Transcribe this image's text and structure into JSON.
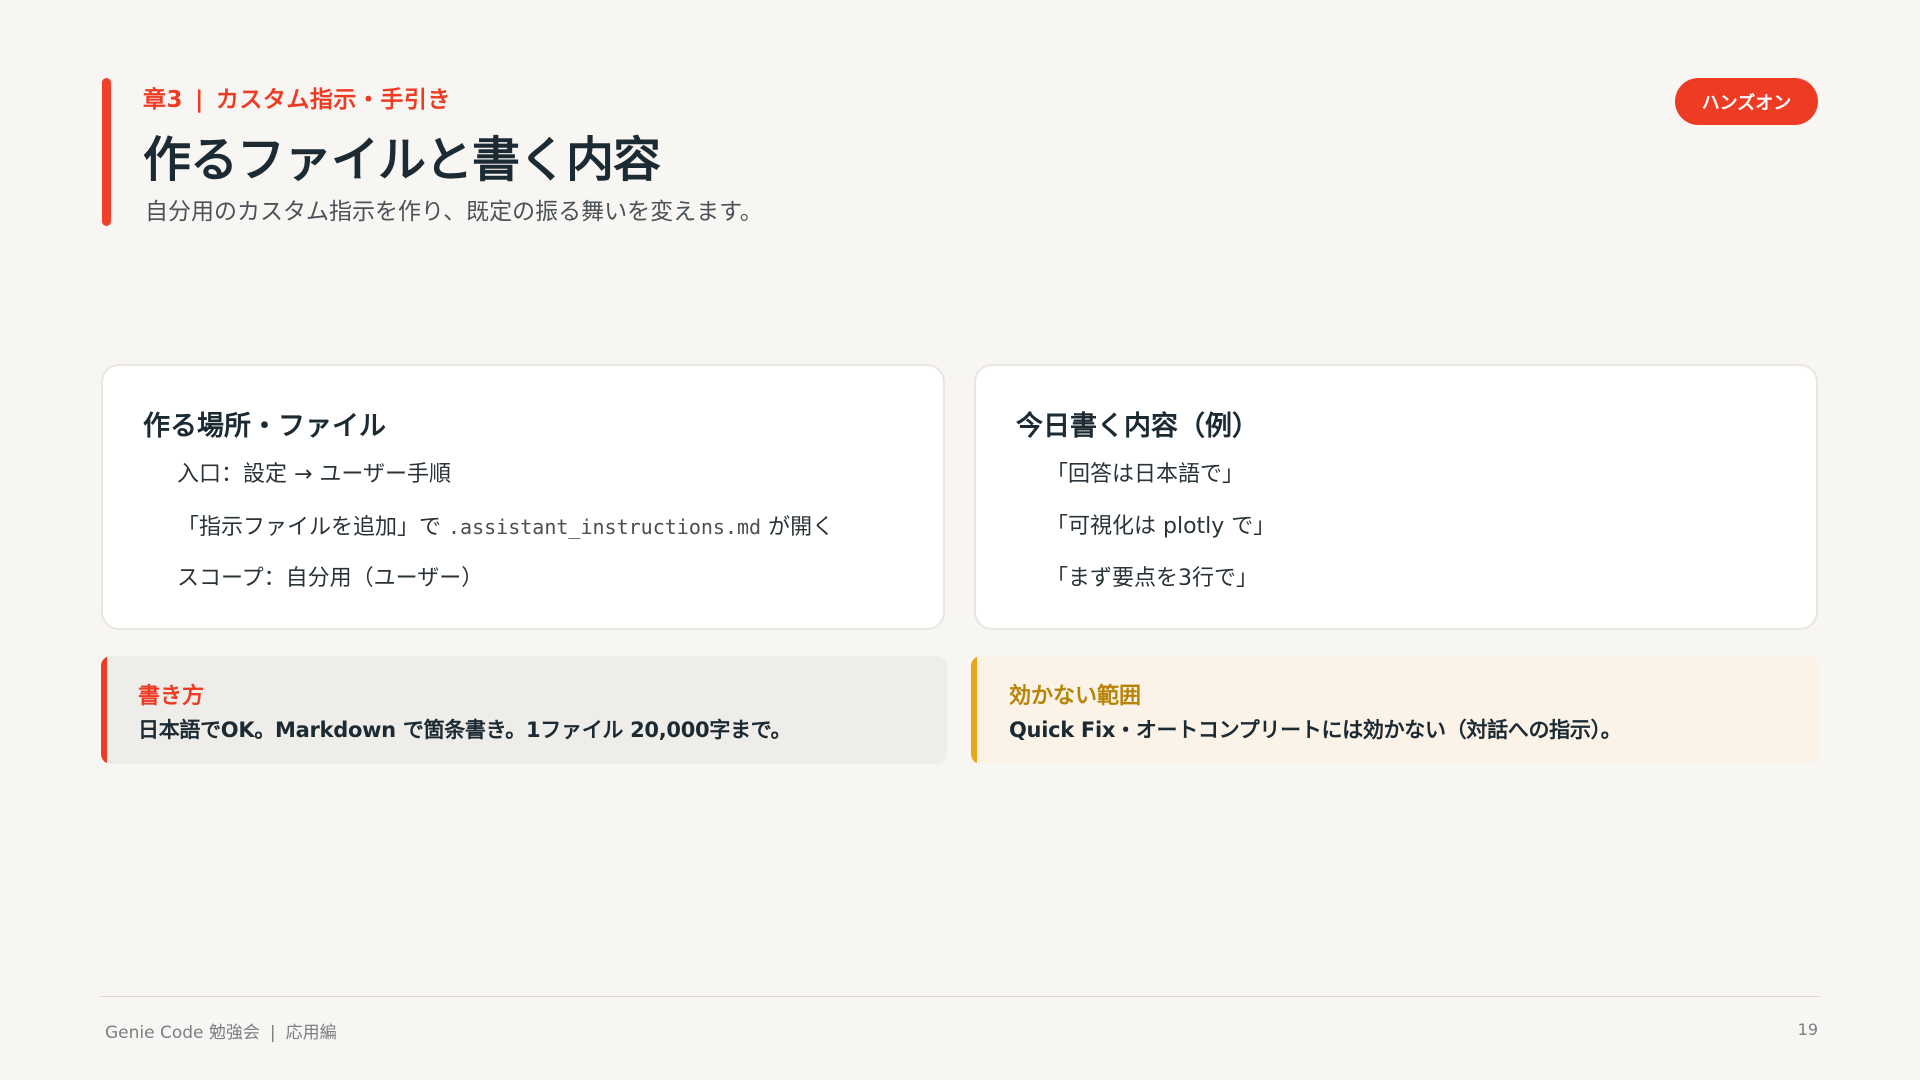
{
  "header": {
    "chapter": "章3",
    "chapter_separator": "|",
    "chapter_topic": "カスタム指示・手引き",
    "title": "作るファイルと書く内容",
    "subtitle": "自分用のカスタム指示を作り、既定の振る舞いを変えます。",
    "badge": "ハンズオン"
  },
  "cards": {
    "left": {
      "title": "作る場所・ファイル",
      "items": {
        "item1": "入口：設定 → ユーザー手順",
        "item2_prefix": "「指示ファイルを追加」で ",
        "item2_code": ".assistant_instructions.md",
        "item2_suffix": " が開く",
        "item3": "スコープ：自分用（ユーザー）"
      }
    },
    "right": {
      "title": "今日書く内容（例）",
      "items": [
        "「回答は日本語で」",
        "「可視化は plotly で」",
        "「まず要点を3行で」"
      ]
    }
  },
  "notes": {
    "left": {
      "title": "書き方",
      "body": "日本語でOK。Markdown で箇条書き。1ファイル 20,000字まで。"
    },
    "right": {
      "title": "効かない範囲",
      "body": "Quick Fix・オートコンプリートには効かない（対話への指示）。"
    }
  },
  "footer": {
    "deck": "Genie Code 勉強会",
    "separator": "|",
    "section": "応用編",
    "page_number": "19"
  },
  "colors": {
    "accent": "#ee3b24",
    "warning": "#e9a51c",
    "background": "#f8f6f3"
  }
}
